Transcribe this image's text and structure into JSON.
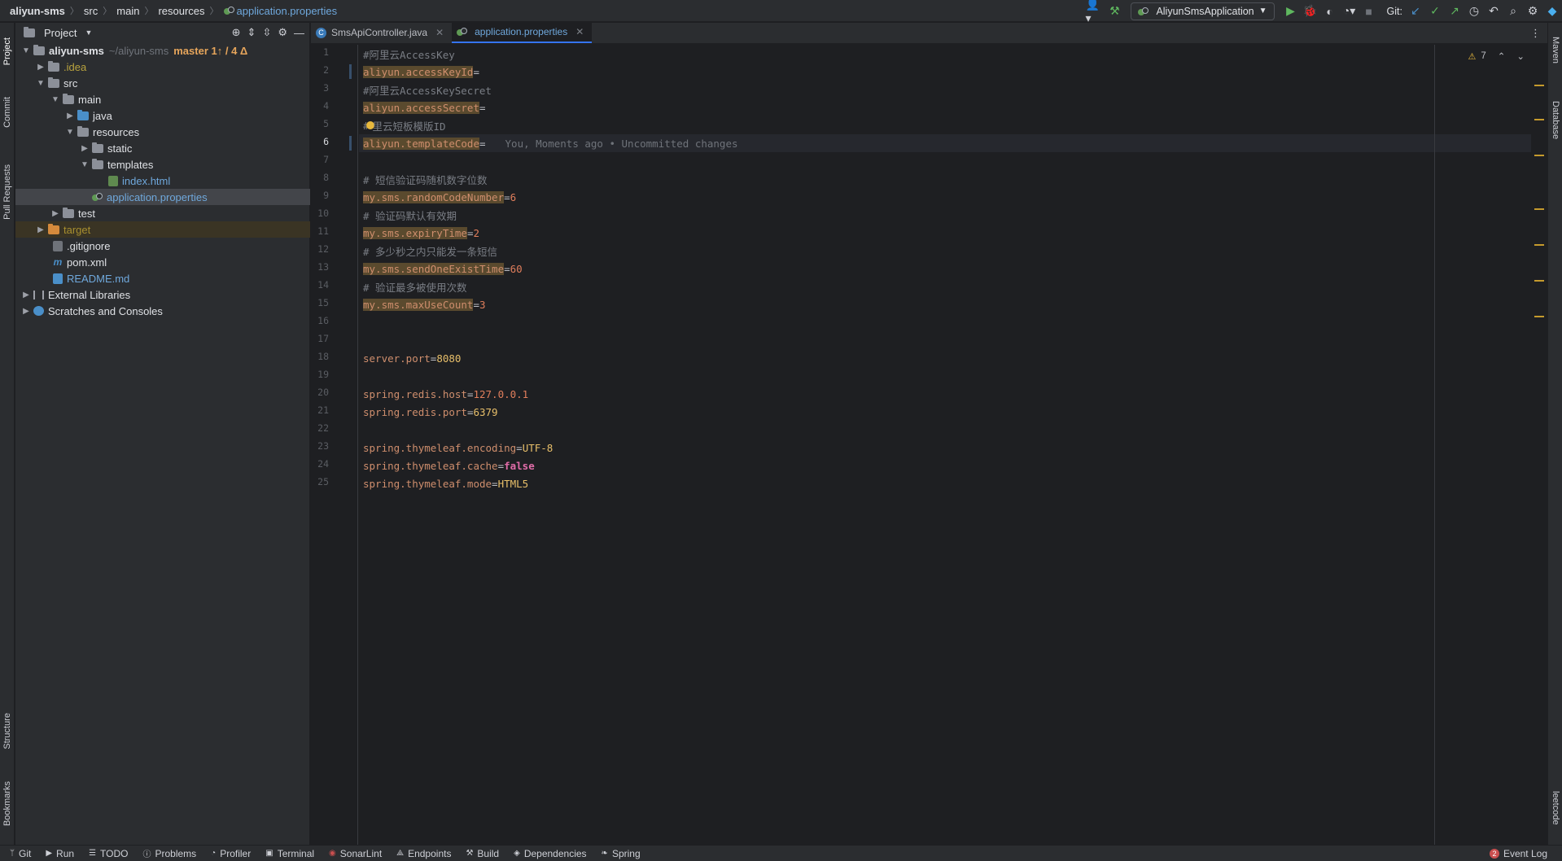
{
  "breadcrumb": {
    "project": "aliyun-sms",
    "p1": "src",
    "p2": "main",
    "p3": "resources",
    "file": "application.properties"
  },
  "toolbar": {
    "run_config": "AliyunSmsApplication",
    "git_label": "Git:"
  },
  "left_tabs": {
    "project": "Project",
    "commit": "Commit",
    "pull_requests": "Pull Requests",
    "structure": "Structure",
    "bookmarks": "Bookmarks"
  },
  "right_tabs": {
    "maven": "Maven",
    "database": "Database",
    "leetcode": "leetcode"
  },
  "project_panel": {
    "title": "Project",
    "root_name": "aliyun-sms",
    "root_path": "~/aliyun-sms",
    "root_branch": "master 1↑ / 4 Δ",
    "items": {
      "idea": ".idea",
      "src": "src",
      "main": "main",
      "java": "java",
      "resources": "resources",
      "static": "static",
      "templates": "templates",
      "index": "index.html",
      "appprops": "application.properties",
      "test": "test",
      "target": "target",
      "gitignore": ".gitignore",
      "pom": "pom.xml",
      "readme": "README.md",
      "extlibs": "External Libraries",
      "scratches": "Scratches and Consoles"
    }
  },
  "editor_tabs": {
    "tab1": "SmsApiController.java",
    "tab2": "application.properties"
  },
  "inspection": {
    "warnings": "7"
  },
  "code": {
    "l1": "#阿里云AccessKey",
    "l2_key": "aliyun.accessKeyId",
    "l3": "#阿里云AccessKeySecret",
    "l4_key": "aliyun.accessSecret",
    "l5_pre": "#",
    "l5_post": "里云短板模版ID",
    "l6_key": "aliyun.templateCode",
    "l6_blame": "You, Moments ago • Uncommitted changes",
    "l8": "# 短信验证码随机数字位数",
    "l9_key": "my.sms.randomCodeNumber",
    "l9_val": "6",
    "l10": "# 验证码默认有效期",
    "l11_key": "my.sms.expiryTime",
    "l11_val": "2",
    "l12": "# 多少秒之内只能发一条短信",
    "l13_key": "my.sms.sendOneExistTime",
    "l13_val": "60",
    "l14": "# 验证最多被使用次数",
    "l15_key": "my.sms.maxUseCount",
    "l15_val": "3",
    "l18_key": "server.port",
    "l18_val": "8080",
    "l20_key": "spring.redis.host",
    "l20_val": "127.0.0.1",
    "l21_key": "spring.redis.port",
    "l21_val": "6379",
    "l23_key": "spring.thymeleaf.encoding",
    "l23_val": "UTF-8",
    "l24_key": "spring.thymeleaf.cache",
    "l24_val": "false",
    "l25_key": "spring.thymeleaf.mode",
    "l25_val": "HTML5"
  },
  "bottom": {
    "git": "Git",
    "run": "Run",
    "todo": "TODO",
    "problems": "Problems",
    "profiler": "Profiler",
    "terminal": "Terminal",
    "sonarlint": "SonarLint",
    "endpoints": "Endpoints",
    "build": "Build",
    "dependencies": "Dependencies",
    "spring": "Spring",
    "event_log": "Event Log",
    "event_count": "2"
  }
}
